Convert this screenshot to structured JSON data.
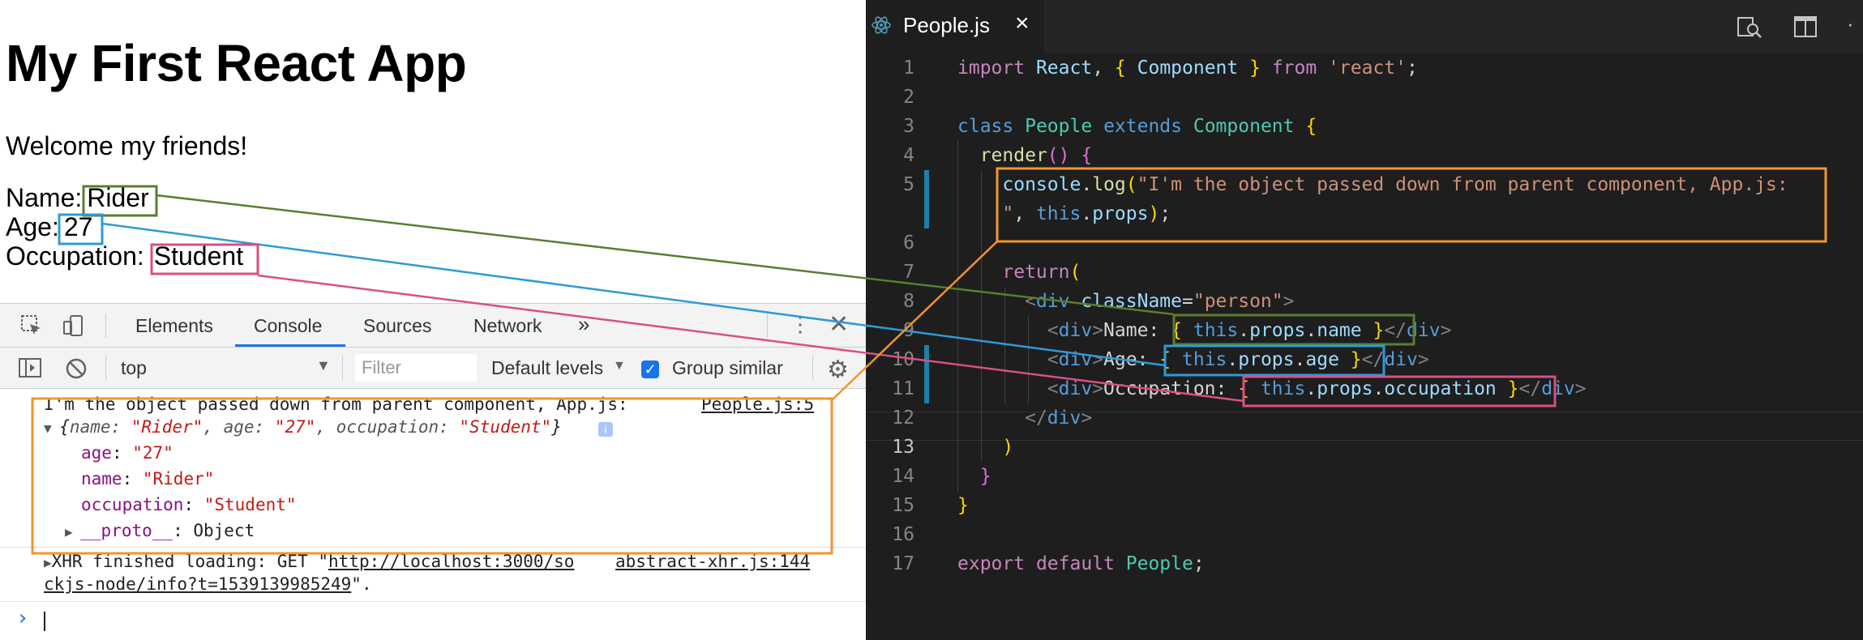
{
  "app": {
    "title": "My First React App",
    "welcome": "Welcome my friends!",
    "fields": [
      {
        "label": "Name:",
        "value": "Rider"
      },
      {
        "label": "Age:",
        "value": "27"
      },
      {
        "label": "Occupation:",
        "value": "Student"
      }
    ]
  },
  "devtools": {
    "tabs": [
      "Elements",
      "Console",
      "Sources",
      "Network",
      "»"
    ],
    "active_tab": "Console",
    "context": "top",
    "filter_placeholder": "Filter",
    "levels": "Default levels",
    "group_similar": "Group similar",
    "log_message": "I'm the object passed down from parent component, App.js:",
    "log_source": "People.js:5",
    "object_summary": {
      "open": "{",
      "name_key": "name: ",
      "name_val": "\"Rider\"",
      "age_key": ", age: ",
      "age_val": "\"27\"",
      "occ_key": ", occupation: ",
      "occ_val": "\"Student\"",
      "close": "}"
    },
    "props": [
      {
        "key": "age",
        "value": "\"27\""
      },
      {
        "key": "name",
        "value": "\"Rider\""
      },
      {
        "key": "occupation",
        "value": "\"Student\""
      }
    ],
    "proto_key": "__proto__",
    "proto_val": ": Object",
    "xhr_prefix": "XHR finished loading: GET \"",
    "xhr_url_1": "http://localhost:3000/so",
    "xhr_url_2": "ckjs-node/info?t=1539139985249",
    "xhr_suffix": "\".",
    "xhr_source": "abstract-xhr.js:144",
    "prompt": "›"
  },
  "editor": {
    "tab_name": "People.js",
    "tab_close": "×",
    "current_line": 13,
    "line_numbers": [
      "1",
      "2",
      "3",
      "4",
      "5",
      "",
      "6",
      "7",
      "8",
      "9",
      "10",
      "11",
      "12",
      "13",
      "14",
      "15",
      "16",
      "17"
    ]
  },
  "colors": {
    "green_box": "#5a7d2f",
    "blue_box": "#2e9ad8",
    "pink_box": "#d84f86",
    "orange_box": "#f3952d"
  }
}
